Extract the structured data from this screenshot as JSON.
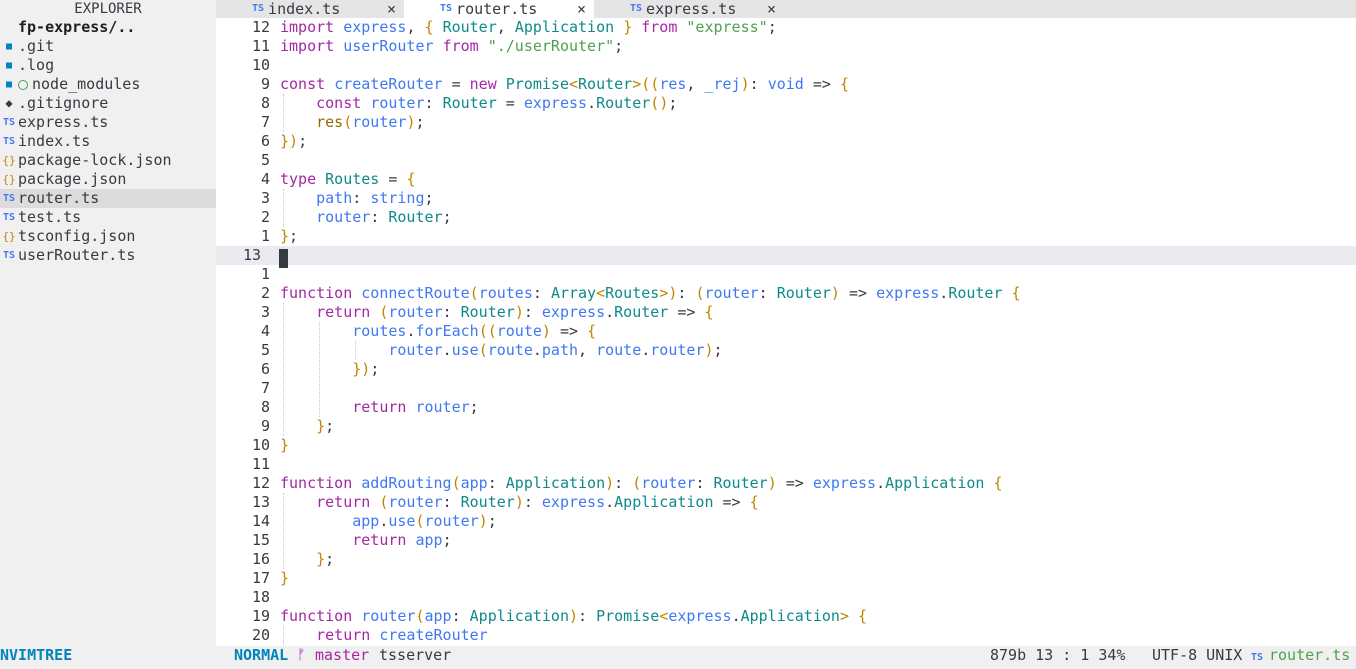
{
  "explorer": {
    "title": "EXPLORER",
    "root": "fp-express/..",
    "items": [
      {
        "icon": "folder-icon",
        "name": ".git"
      },
      {
        "icon": "folder-icon",
        "name": ".log"
      },
      {
        "icon": "folder-icon",
        "name": "node_modules"
      },
      {
        "icon": "git-icon",
        "name": ".gitignore"
      },
      {
        "icon": "ts-file-icon",
        "name": "express.ts"
      },
      {
        "icon": "ts-file-icon",
        "name": "index.ts"
      },
      {
        "icon": "json-file-icon",
        "name": "package-lock.json"
      },
      {
        "icon": "json-file-icon",
        "name": "package.json"
      },
      {
        "icon": "ts-file-icon",
        "name": "router.ts",
        "selected": true
      },
      {
        "icon": "ts-file-icon",
        "name": "test.ts"
      },
      {
        "icon": "json-file-icon",
        "name": "tsconfig.json"
      },
      {
        "icon": "ts-file-icon",
        "name": "userRouter.ts"
      }
    ]
  },
  "tabs": [
    {
      "icon": "TS",
      "label": "index.ts",
      "close": "×"
    },
    {
      "icon": "TS",
      "label": "router.ts",
      "close": "×",
      "active": true
    },
    {
      "icon": "TS",
      "label": "express.ts",
      "close": "×"
    }
  ],
  "editor": {
    "line_numbers": [
      "12",
      "11",
      "10",
      "9",
      "8",
      "7",
      "6",
      "5",
      "4",
      "3",
      "2",
      "1",
      "13",
      "1",
      "2",
      "3",
      "4",
      "5",
      "6",
      "7",
      "8",
      "9",
      "10",
      "11",
      "12",
      "13",
      "14",
      "15",
      "16",
      "17",
      "18",
      "19",
      "20"
    ],
    "current_line": "13",
    "lines": [
      "import express, { Router, Application } from \"express\";",
      "import userRouter from \"./userRouter\";",
      "",
      "const createRouter = new Promise<Router>((res, _rej): void => {",
      "    const router: Router = express.Router();",
      "    res(router);",
      "});",
      "",
      "type Routes = {",
      "    path: string;",
      "    router: Router;",
      "};",
      "",
      "",
      "function connectRoute(routes: Array<Routes>): (router: Router) => express.Router {",
      "    return (router: Router): express.Router => {",
      "        routes.forEach((route) => {",
      "            router.use(route.path, route.router);",
      "        });",
      "",
      "        return router;",
      "    };",
      "}",
      "",
      "function addRouting(app: Application): (router: Router) => express.Application {",
      "    return (router: Router): express.Application => {",
      "        app.use(router);",
      "        return app;",
      "    };",
      "}",
      "",
      "function router(app: Application): Promise<express.Application> {",
      "    return createRouter"
    ]
  },
  "statusbar": {
    "tree": "NVIMTREE",
    "mode": "NORMAL",
    "branch_icon": "ᚠ",
    "branch": "master",
    "lsp": "tsserver",
    "info": "879b 13 : 1 34%",
    "encoding": "UTF-8 UNIX",
    "file_icon": "TS",
    "file": "router.ts"
  },
  "colors": {
    "keyword": "#a626a4",
    "function": "#4078f2",
    "type": "#0e8a8a",
    "string": "#50a14f",
    "bracket": "#c18401",
    "accent": "#0184bc"
  }
}
